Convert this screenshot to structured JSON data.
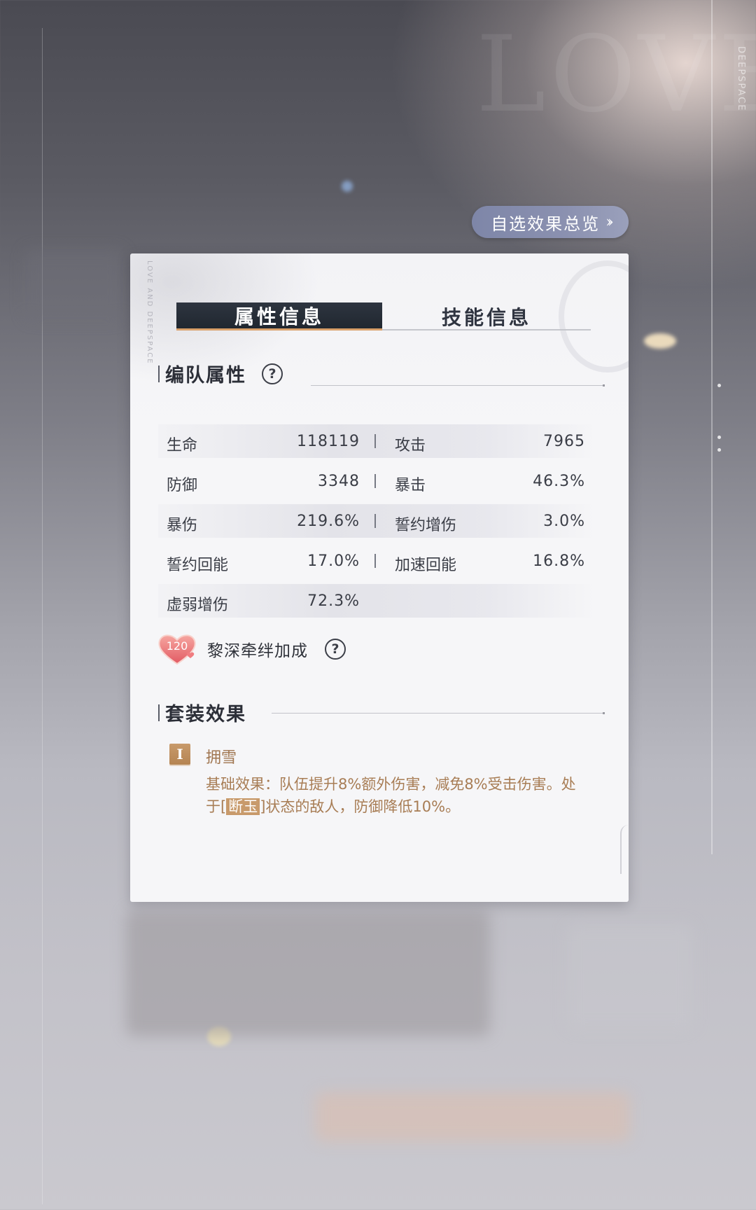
{
  "background": {
    "brand_vertical": "DEEPSPACE",
    "ghost_text": "LOVE"
  },
  "overview_button": {
    "label": "自选效果总览",
    "icon": "double-chevron-right-icon"
  },
  "card": {
    "watermark": "LOVE AND DEEPSPACE",
    "tabs": [
      {
        "label": "属性信息",
        "active": true
      },
      {
        "label": "技能信息",
        "active": false
      }
    ],
    "team_attributes": {
      "title": "编队属性",
      "help_icon": "question-circle-icon",
      "rows": [
        {
          "left_label": "生命",
          "left_value": "118119",
          "right_label": "攻击",
          "right_value": "7965"
        },
        {
          "left_label": "防御",
          "left_value": "3348",
          "right_label": "暴击",
          "right_value": "46.3%"
        },
        {
          "left_label": "暴伤",
          "left_value": "219.6%",
          "right_label": "誓约增伤",
          "right_value": "3.0%"
        },
        {
          "left_label": "誓约回能",
          "left_value": "17.0%",
          "right_label": "加速回能",
          "right_value": "16.8%"
        },
        {
          "left_label": "虚弱增伤",
          "left_value": "72.3%",
          "right_label": "",
          "right_value": ""
        }
      ]
    },
    "bond": {
      "level": "120",
      "label": "黎深牵绊加成",
      "icon": "heart-badge-icon",
      "help_icon": "question-circle-icon"
    },
    "set_effect": {
      "title": "套装效果",
      "items": [
        {
          "tier": "I",
          "name": "拥雪",
          "desc_before": "基础效果：队伍提升8%额外伤害，减免8%受击伤害。处于[",
          "desc_highlight": "断玉",
          "desc_after": "]状态的敌人，防御降低10%。"
        }
      ]
    }
  },
  "colors": {
    "tab_active_bg": "#262c36",
    "tab_accent": "#d9a06a",
    "set_text": "#a87d55",
    "button_bg": "#858cab"
  }
}
